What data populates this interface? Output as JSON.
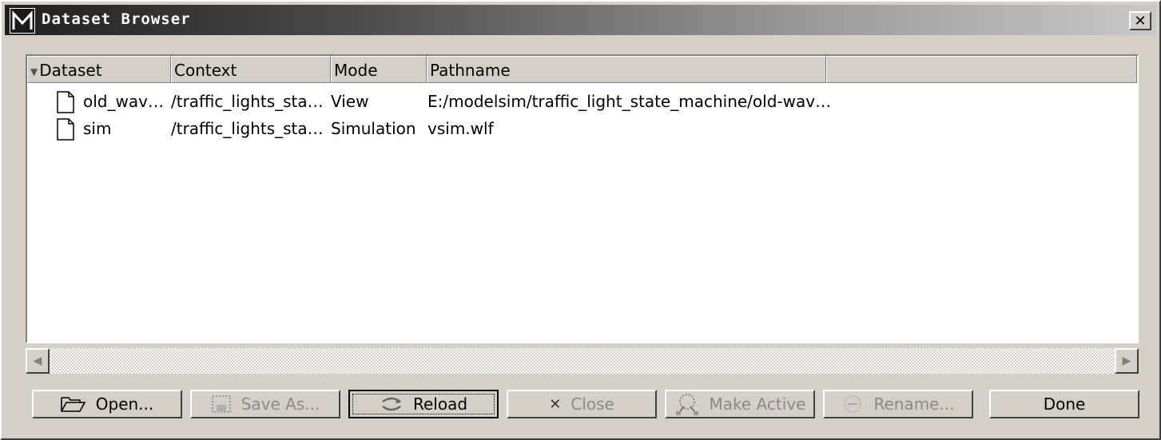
{
  "window": {
    "title": "Dataset Browser",
    "close_label": "✕"
  },
  "columns": [
    {
      "label": "Dataset"
    },
    {
      "label": "Context"
    },
    {
      "label": "Mode"
    },
    {
      "label": "Pathname"
    },
    {
      "label": ""
    }
  ],
  "rows": [
    {
      "dataset": "old_wav…",
      "context": "/traffic_lights_sta…",
      "mode": "View",
      "pathname": "E:/modelsim/traffic_light_state_machine/old-wav…"
    },
    {
      "dataset": "sim",
      "context": "/traffic_lights_sta…",
      "mode": "Simulation",
      "pathname": "vsim.wlf"
    }
  ],
  "buttons": {
    "open": {
      "label": "Open...",
      "icon": "folder-open-icon"
    },
    "save_as": {
      "label": "Save As...",
      "icon": "save-icon"
    },
    "reload": {
      "label": "Reload",
      "icon": "reload-icon"
    },
    "close": {
      "label": "Close",
      "icon": "x-icon"
    },
    "make_active": {
      "label": "Make Active",
      "icon": "make-active-icon"
    },
    "rename": {
      "label": "Rename...",
      "icon": "rename-icon"
    },
    "done": {
      "label": "Done"
    }
  },
  "colors": {
    "face": "#d4d0c8",
    "titlebar_dark": "#202020",
    "disabled_text": "#8a8a8a"
  }
}
